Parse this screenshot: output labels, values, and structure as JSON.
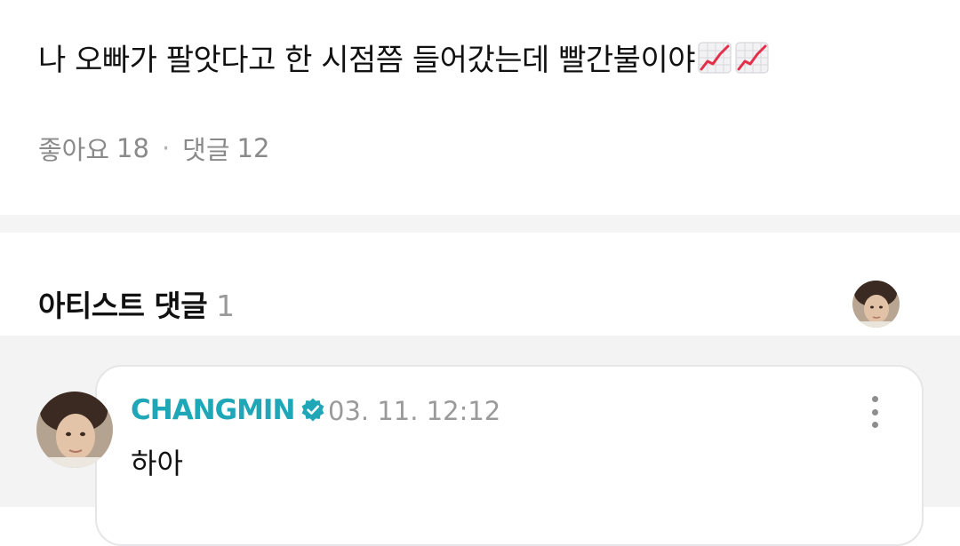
{
  "post": {
    "text": "나 오빠가 팔앗다고 한 시점쯤 들어갔는데 빨간불이야",
    "emoji_icons": [
      "chart-increasing-icon",
      "chart-increasing-icon"
    ]
  },
  "meta": {
    "likes_label": "좋아요",
    "likes_count": "18",
    "separator": "·",
    "comments_label": "댓글",
    "comments_count": "12"
  },
  "artist_comments": {
    "title": "아티스트 댓글",
    "count": "1"
  },
  "comment": {
    "author": "CHANGMIN",
    "verified_icon": "verified-badge-icon",
    "timestamp": "03. 11. 12:12",
    "text": "하아",
    "menu_icon": "more-vertical-icon"
  },
  "colors": {
    "author": "#1fa7b8",
    "muted": "#8a8a8a",
    "chart_line": "#e2304a"
  }
}
